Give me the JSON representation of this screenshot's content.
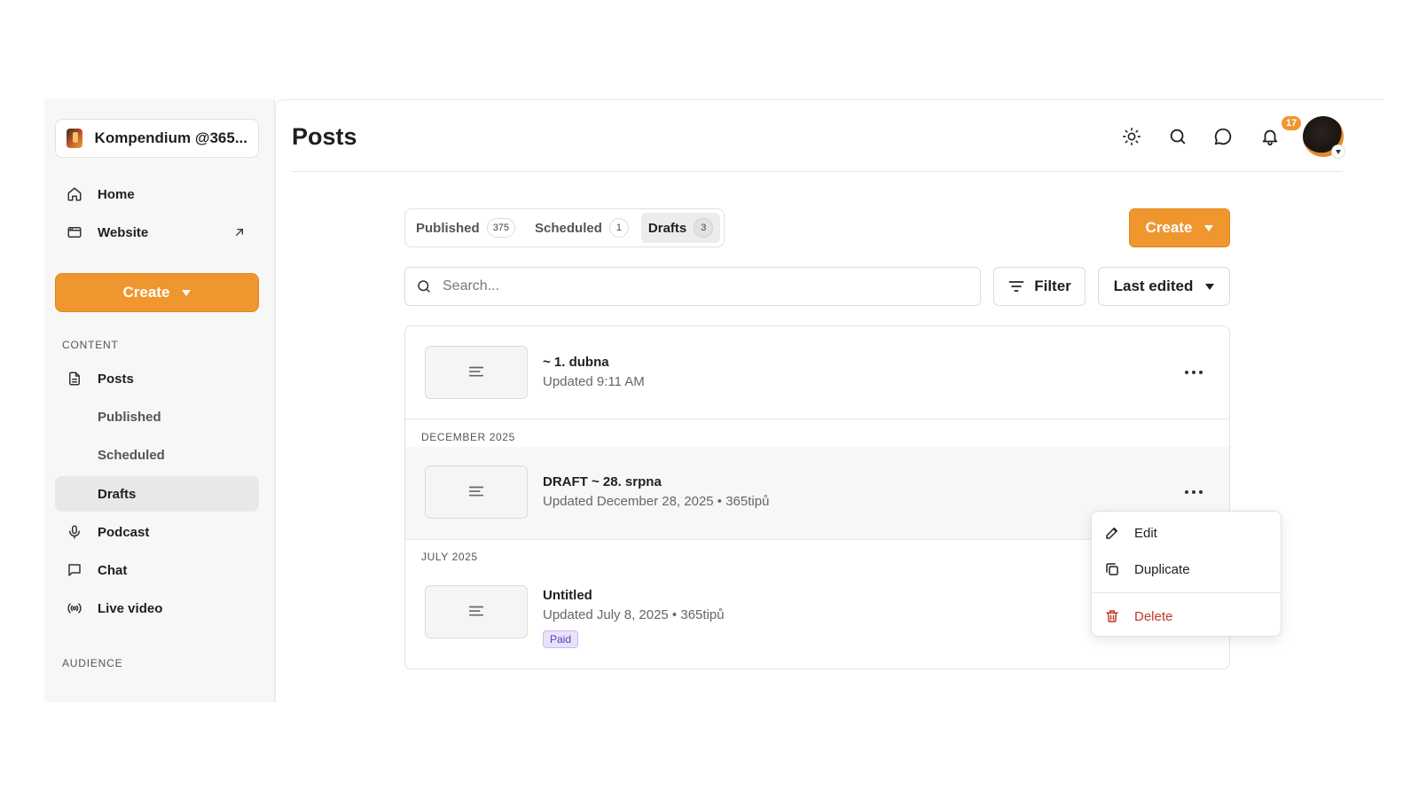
{
  "sidebar": {
    "publication": "Kompendium @365...",
    "nav": {
      "home": "Home",
      "website": "Website",
      "create": "Create",
      "content_label": "CONTENT",
      "posts": "Posts",
      "published": "Published",
      "scheduled": "Scheduled",
      "drafts": "Drafts",
      "podcast": "Podcast",
      "chat": "Chat",
      "live_video": "Live video",
      "audience_label": "AUDIENCE"
    },
    "active_item": "Drafts"
  },
  "header": {
    "title": "Posts",
    "notification_count": "17",
    "icons": [
      "sun-icon",
      "search-icon",
      "chat-bubble-icon",
      "bell-icon"
    ]
  },
  "tabs": [
    {
      "label": "Published",
      "count": "375"
    },
    {
      "label": "Scheduled",
      "count": "1"
    },
    {
      "label": "Drafts",
      "count": "3"
    }
  ],
  "active_tab": "Drafts",
  "toolbar": {
    "create_label": "Create",
    "search_placeholder": "Search...",
    "filter_label": "Filter",
    "sort_label": "Last edited"
  },
  "posts": {
    "first": {
      "title": "~ 1. dubna",
      "meta": "Updated 9:11 AM"
    },
    "group_december": "DECEMBER 2025",
    "second": {
      "title": "DRAFT ~ 28. srpna",
      "meta": "Updated December 28, 2025 • 365tipů"
    },
    "group_july": "JULY 2025",
    "third": {
      "title": "Untitled",
      "meta": "Updated July 8, 2025 • 365tipů",
      "badge": "Paid"
    }
  },
  "context_menu": {
    "edit": "Edit",
    "duplicate": "Duplicate",
    "delete": "Delete"
  },
  "colors": {
    "accent": "#f0962f",
    "danger": "#c0392b",
    "paid_badge": "#5b3db3"
  }
}
